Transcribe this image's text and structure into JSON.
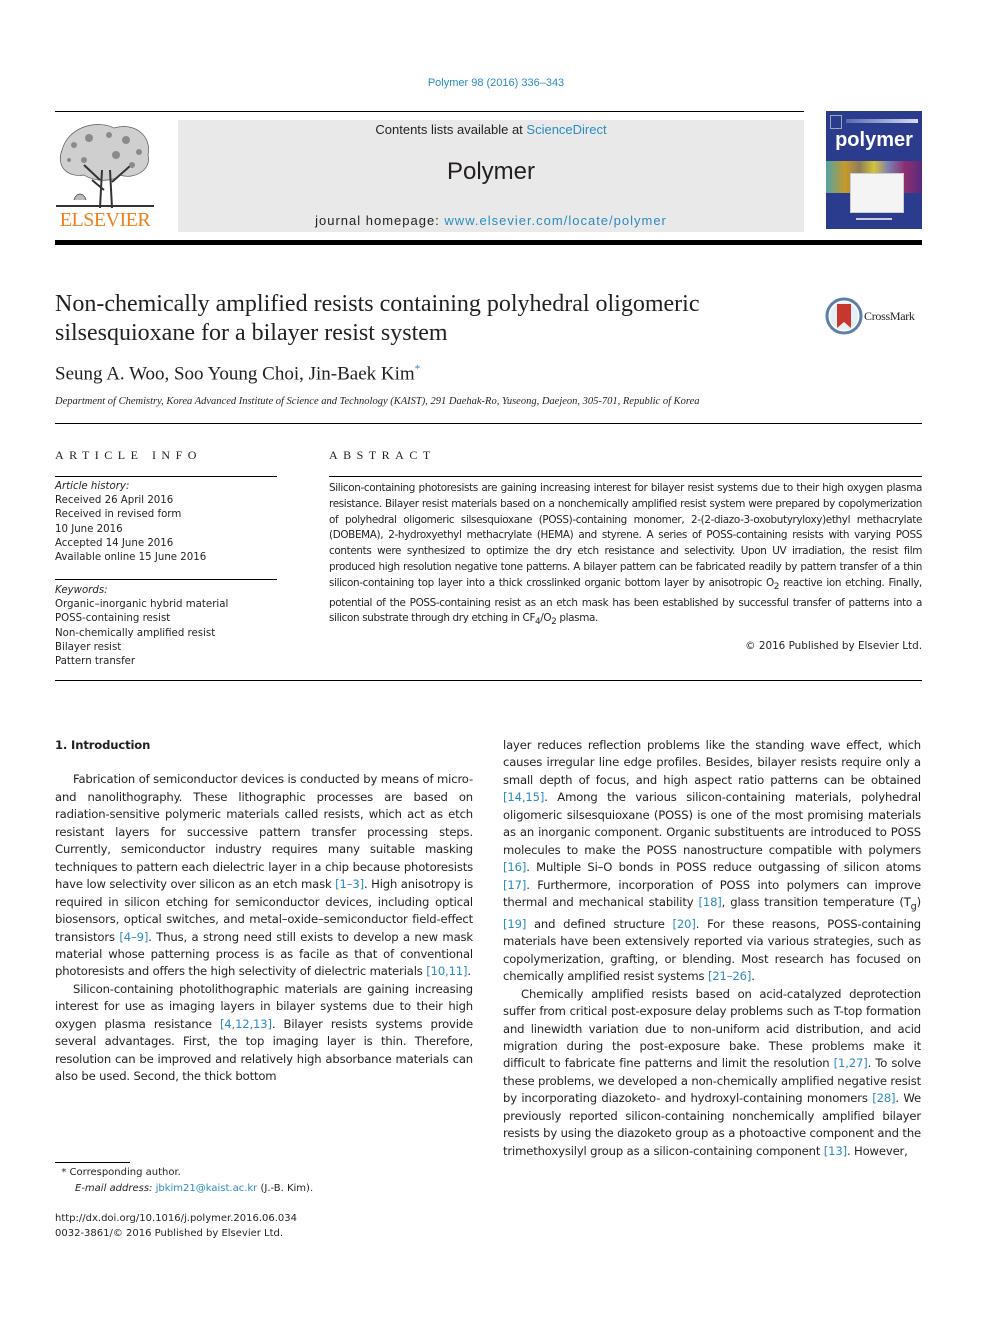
{
  "header": {
    "citation": "Polymer 98 (2016) 336–343",
    "contents_prefix": "Contents lists available at ",
    "contents_link": "ScienceDirect",
    "journal_name": "Polymer",
    "homepage_prefix": "journal homepage: ",
    "homepage_link": "www.elsevier.com/locate/polymer",
    "publisher_logo_text": "ELSEVIER",
    "cover_title": "polymer",
    "crossmark_label": "CrossMark"
  },
  "article": {
    "title": "Non-chemically amplified resists containing polyhedral oligomeric silsesquioxane for a bilayer resist system",
    "authors": "Seung A. Woo, Soo Young Choi, Jin-Baek Kim",
    "author_mark": "*",
    "affiliation": "Department of Chemistry, Korea Advanced Institute of Science and Technology (KAIST), 291 Daehak-Ro, Yuseong, Daejeon, 305-701, Republic of Korea"
  },
  "article_info": {
    "heading": "ARTICLE INFO",
    "history_label": "Article history:",
    "history": [
      "Received 26 April 2016",
      "Received in revised form",
      "10 June 2016",
      "Accepted 14 June 2016",
      "Available online 15 June 2016"
    ],
    "keywords_label": "Keywords:",
    "keywords": [
      "Organic–inorganic hybrid material",
      "POSS-containing resist",
      "Non-chemically amplified resist",
      "Bilayer resist",
      "Pattern transfer"
    ]
  },
  "abstract": {
    "heading": "ABSTRACT",
    "text_1": "Silicon-containing photoresists are gaining increasing interest for bilayer resist systems due to their high oxygen plasma resistance. Bilayer resist materials based on a nonchemically amplified resist system were prepared by copolymerization of polyhedral oligomeric silsesquioxane (POSS)-containing monomer, 2-(2-diazo-3-oxobutyryloxy)ethyl methacrylate (DOBEMA), 2-hydroxyethyl methacrylate (HEMA) and styrene. A series of POSS-containing resists with varying POSS contents were synthesized to optimize the dry etch resistance and selectivity. Upon UV irradiation, the resist film produced high resolution negative tone patterns. A bilayer pattern can be fabricated readily by pattern transfer of a thin silicon-containing top layer into a thick crosslinked organic bottom layer by anisotropic O",
    "sub_1": "2",
    "text_2": " reactive ion etching. Finally, potential of the POSS-containing resist as an etch mask has been established by successful transfer of patterns into a silicon substrate through dry etching in CF",
    "sub_2": "4",
    "text_3": "/O",
    "sub_3": "2",
    "text_4": " plasma.",
    "copyright": "© 2016 Published by Elsevier Ltd."
  },
  "body": {
    "section_heading": "1.  Introduction",
    "p1": [
      {
        "t": "Fabrication of semiconductor devices is conducted by means of micro- and nanolithography. These lithographic processes are based on radiation-sensitive polymeric materials called resists, which act as etch resistant layers for successive pattern transfer processing steps. Currently, semiconductor industry requires many suitable masking techniques to pattern each dielectric layer in a chip because photoresists have low selectivity over silicon as an etch mask "
      },
      {
        "r": "[1–3]"
      },
      {
        "t": ". High anisotropy is required in silicon etching for semiconductor devices, including optical biosensors, optical switches, and metal–oxide–semiconductor field-effect transistors "
      },
      {
        "r": "[4–9]"
      },
      {
        "t": ". Thus, a strong need still exists to develop a new mask material whose patterning process is as facile as that of conventional photoresists and offers the high selectivity of dielectric materials "
      },
      {
        "r": "[10,11]"
      },
      {
        "t": "."
      }
    ],
    "p2": [
      {
        "t": "Silicon-containing photolithographic materials are gaining increasing interest for use as imaging layers in bilayer systems due to their high oxygen plasma resistance "
      },
      {
        "r": "[4,12,13]"
      },
      {
        "t": ". Bilayer resists systems provide several advantages. First, the top imaging layer is thin. Therefore, resolution can be improved and relatively high absorbance materials can also be used. Second, the thick bottom"
      }
    ],
    "p3": [
      {
        "t": "layer reduces reflection problems like the standing wave effect, which causes irregular line edge profiles. Besides, bilayer resists require only a small depth of focus, and high aspect ratio patterns can be obtained "
      },
      {
        "r": "[14,15]"
      },
      {
        "t": ". Among the various silicon-containing materials, polyhedral oligomeric silsesquioxane (POSS) is one of the most promising materials as an inorganic component. Organic substituents are introduced to POSS molecules to make the POSS nanostructure compatible with polymers "
      },
      {
        "r": "[16]"
      },
      {
        "t": ". Multiple Si–O bonds in POSS reduce outgassing of silicon atoms "
      },
      {
        "r": "[17]"
      },
      {
        "t": ". Furthermore, incorporation of POSS into polymers can improve thermal and mechanical stability "
      },
      {
        "r": "[18]"
      },
      {
        "t": ", glass transition temperature (T"
      },
      {
        "s": "g"
      },
      {
        "t": ") "
      },
      {
        "r": "[19]"
      },
      {
        "t": " and defined structure "
      },
      {
        "r": "[20]"
      },
      {
        "t": ". For these reasons, POSS-containing materials have been extensively reported via various strategies, such as copolymerization, grafting, or blending. Most research has focused on chemically amplified resist systems "
      },
      {
        "r": "[21–26]"
      },
      {
        "t": "."
      }
    ],
    "p4": [
      {
        "t": "Chemically amplified resists based on acid-catalyzed deprotection suffer from critical post-exposure delay problems such as T-top formation and linewidth variation due to non-uniform acid distribution, and acid migration during the post-exposure bake. These problems make it difficult to fabricate fine patterns and limit the resolution "
      },
      {
        "r": "[1,27]"
      },
      {
        "t": ". To solve these problems, we developed a non-chemically amplified negative resist by incorporating diazoketo- and hydroxyl-containing monomers "
      },
      {
        "r": "[28]"
      },
      {
        "t": ". We previously reported silicon-containing nonchemically amplified bilayer resists by using the diazoketo group as a photoactive component and the trimethoxysilyl group as a silicon-containing component "
      },
      {
        "r": "[13]"
      },
      {
        "t": ". However,"
      }
    ]
  },
  "footnotes": {
    "corresponding_mark": "*",
    "corresponding_text": " Corresponding author.",
    "email_label": "E-mail address: ",
    "email": "jbkim21@kaist.ac.kr",
    "email_suffix": " (J.-B. Kim).",
    "doi": "http://dx.doi.org/10.1016/j.polymer.2016.06.034",
    "issn": "0032-3861/© 2016 Published by Elsevier Ltd."
  },
  "colors": {
    "link": "#2a8bbf",
    "elsevier_orange": "#f07f1b",
    "banner_gray": "#e9e9e9",
    "cover_blue": "#2b3c8e",
    "crossmark_red": "#c8372d"
  }
}
